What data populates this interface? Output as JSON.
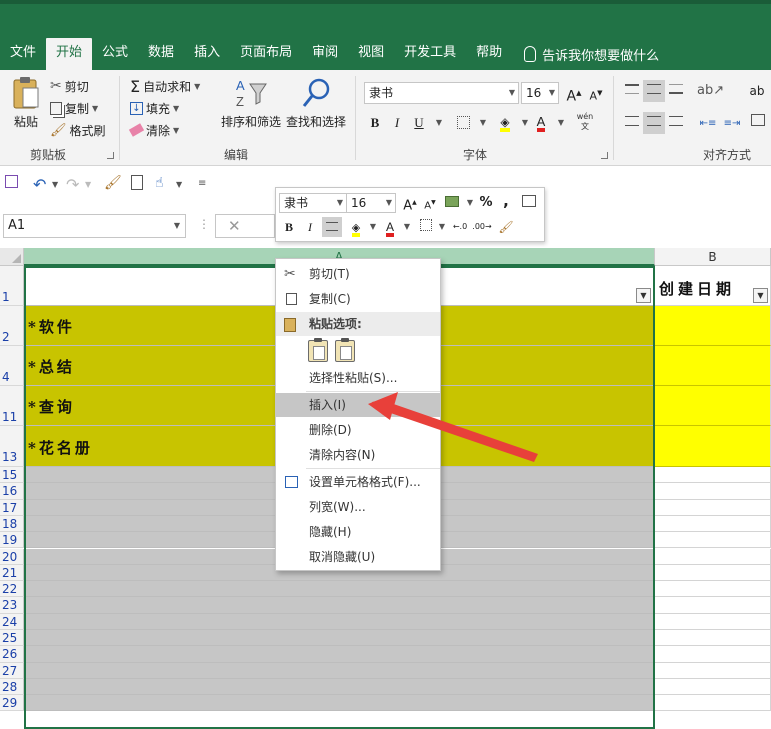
{
  "ribbon": {
    "tabs": [
      "文件",
      "开始",
      "公式",
      "数据",
      "插入",
      "页面布局",
      "审阅",
      "视图",
      "开发工具",
      "帮助"
    ],
    "active_tab": "开始",
    "tell_me": "告诉我你想要做什么",
    "clipboard": {
      "paste": "粘贴",
      "cut": "剪切",
      "copy": "复制",
      "format_painter": "格式刷",
      "title": "剪贴板"
    },
    "editing": {
      "autosum": "自动求和",
      "fill": "填充",
      "clear": "清除",
      "sort_filter": "排序和筛选",
      "find_select": "查找和选择",
      "title": "编辑"
    },
    "font": {
      "name": "隶书",
      "size": "16",
      "bold": "B",
      "italic": "I",
      "underline": "U",
      "title": "字体",
      "grow": "A",
      "shrink": "A",
      "fill_color": "#ffff00",
      "font_color": "#e02020"
    },
    "alignment": {
      "title": "对齐方式",
      "phonetic": "wén\n文"
    }
  },
  "mini_toolbar": {
    "font": "隶书",
    "size": "16",
    "percent": "%",
    "comma": ",",
    "bold": "B",
    "italic": "I"
  },
  "namebox": {
    "value": "A1"
  },
  "formula": {
    "cancel": "✕"
  },
  "columns": {
    "a": "A",
    "b": "B"
  },
  "sheet": {
    "header_b": "创建日期",
    "rows": [
      {
        "num": "1",
        "text": "",
        "kind": "header"
      },
      {
        "num": "2",
        "text": "*软件",
        "kind": "cat"
      },
      {
        "num": "4",
        "text": "*总结",
        "kind": "cat"
      },
      {
        "num": "11",
        "text": "*查询",
        "kind": "cat"
      },
      {
        "num": "13",
        "text": "*花名册",
        "kind": "cat"
      },
      {
        "num": "15"
      },
      {
        "num": "16"
      },
      {
        "num": "17"
      },
      {
        "num": "18"
      },
      {
        "num": "19"
      },
      {
        "num": "20"
      },
      {
        "num": "21"
      },
      {
        "num": "22"
      },
      {
        "num": "23"
      },
      {
        "num": "24"
      },
      {
        "num": "25"
      },
      {
        "num": "26"
      },
      {
        "num": "27"
      },
      {
        "num": "28"
      },
      {
        "num": "29"
      }
    ]
  },
  "context_menu": {
    "cut": "剪切(T)",
    "copy": "复制(C)",
    "paste_options": "粘贴选项:",
    "paste_special": "选择性粘贴(S)...",
    "insert": "插入(I)",
    "delete": "删除(D)",
    "clear_contents": "清除内容(N)",
    "format_cells": "设置单元格格式(F)...",
    "column_width": "列宽(W)...",
    "hide": "隐藏(H)",
    "unhide": "取消隐藏(U)"
  },
  "colors": {
    "excel_green": "#217346",
    "category_fill": "#c8c400",
    "date_fill": "#ffff00",
    "grey_fill": "#c6c6c6",
    "arrow": "#e8403a"
  }
}
